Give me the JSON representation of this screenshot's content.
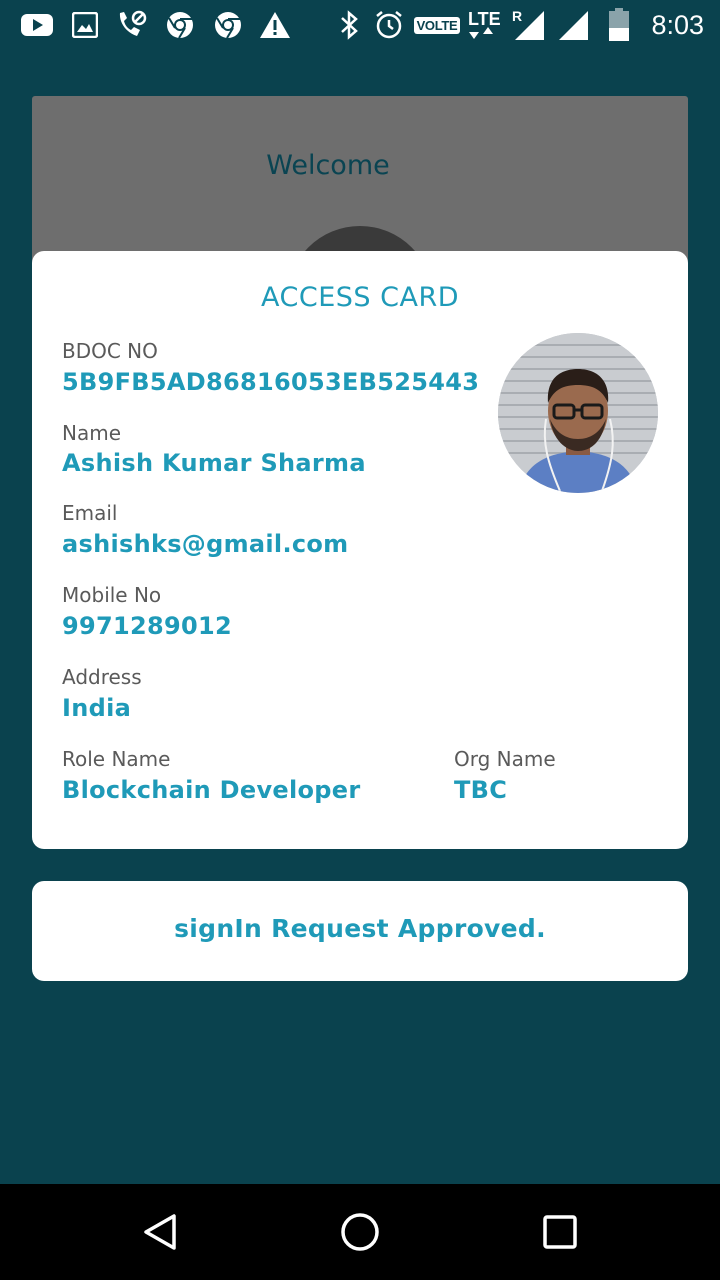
{
  "status_bar": {
    "time": "8:03",
    "volte_label": "VOLTE",
    "lte_label": "LTE",
    "roaming_label": "R",
    "icons": [
      "youtube-icon",
      "gallery-icon",
      "missed-call-icon",
      "chrome-icon",
      "chrome-icon",
      "warning-icon",
      "bluetooth-icon",
      "alarm-icon",
      "volte-icon",
      "lte-icon",
      "signal-icon",
      "signal-icon",
      "battery-icon"
    ]
  },
  "background": {
    "welcome_title": "Welcome"
  },
  "access_card": {
    "title": "ACCESS CARD",
    "photo_icon": "profile-photo",
    "fields": {
      "bdoc_label": "BDOC NO",
      "bdoc_value": "5B9FB5AD86816053EB525443",
      "name_label": "Name",
      "name_value": "Ashish Kumar Sharma",
      "email_label": "Email",
      "email_value": "ashishks@gmail.com",
      "mobile_label": "Mobile No",
      "mobile_value": "9971289012",
      "address_label": "Address",
      "address_value": "India",
      "role_label": "Role Name",
      "role_value": "Blockchain Developer",
      "org_label": "Org Name",
      "org_value": "TBC"
    }
  },
  "signin": {
    "message": "signIn Request Approved."
  },
  "nav_bar": {
    "buttons": [
      "back-icon",
      "home-icon",
      "recents-icon"
    ]
  },
  "colors": {
    "background": "#0a424e",
    "accent": "#1f9ab8",
    "card": "#ffffff",
    "label": "#5a5a5a"
  }
}
